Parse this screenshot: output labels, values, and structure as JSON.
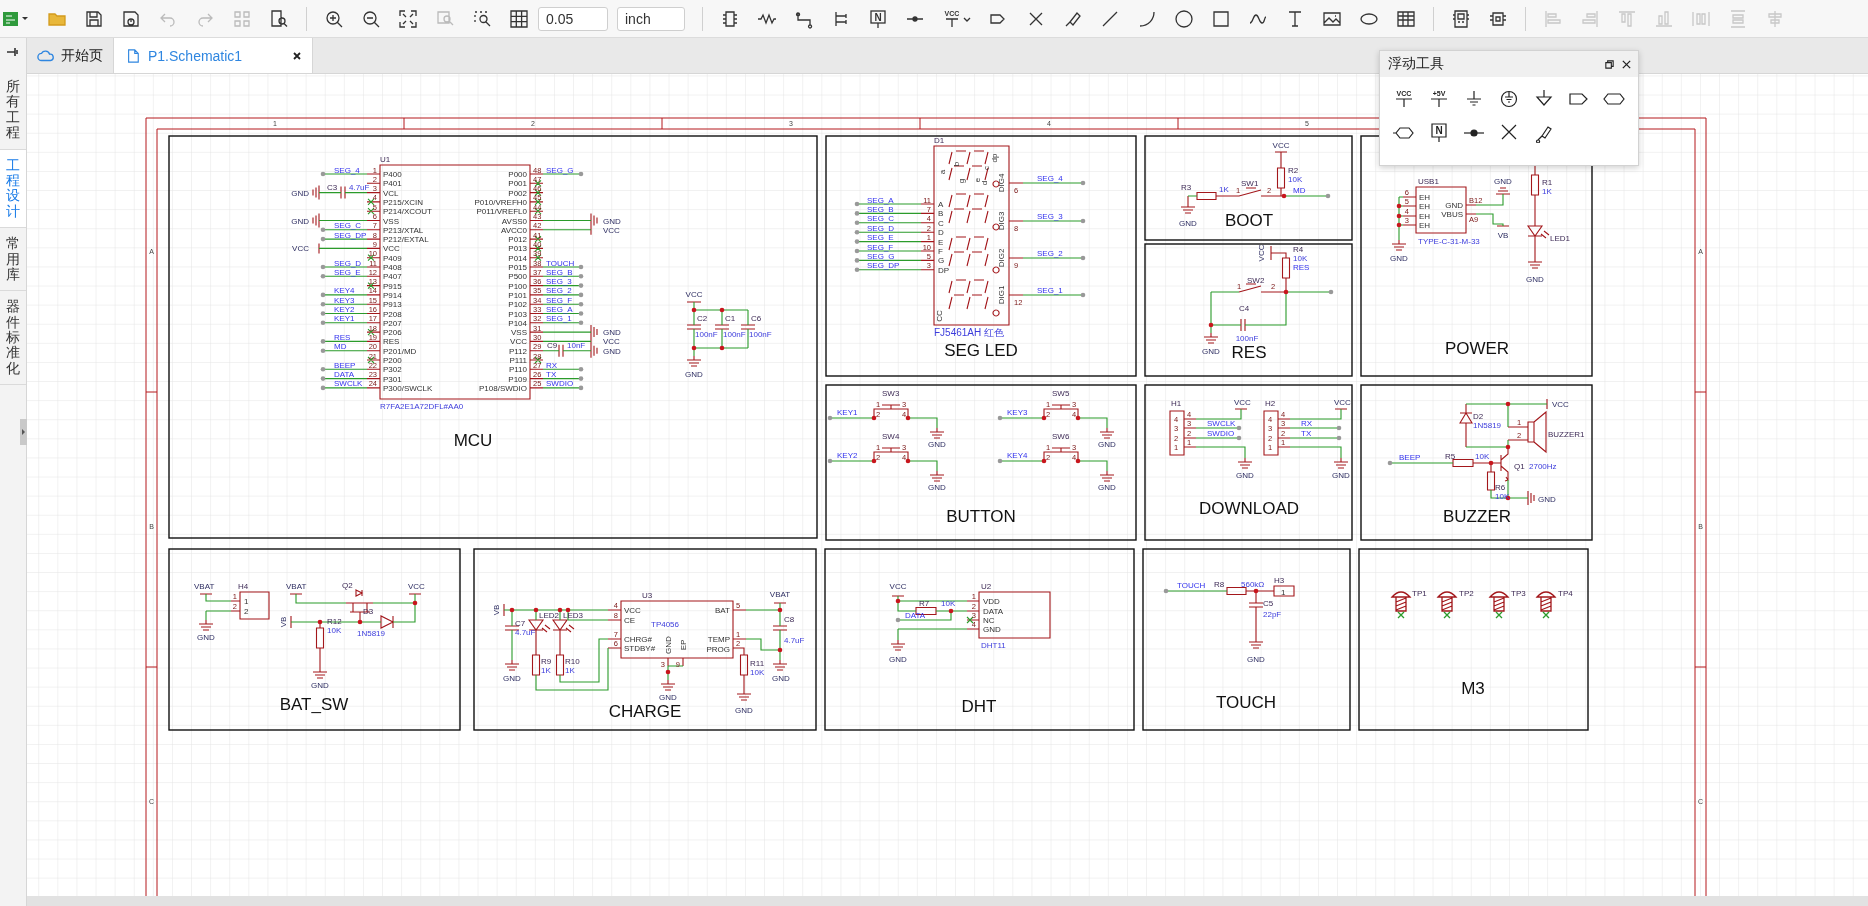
{
  "toolbar": {
    "power_label": "VCC",
    "netlabel_label": "N",
    "grid_size": "0.05",
    "unit": "inch"
  },
  "sidebar": {
    "items": [
      {
        "label": "所有工程",
        "selected": false
      },
      {
        "label": "工程设计",
        "selected": true
      },
      {
        "label": "常用库",
        "selected": false
      },
      {
        "label": "器件标准化",
        "selected": false
      }
    ]
  },
  "tabs": [
    {
      "label": "开始页",
      "kind": "start",
      "selected": false,
      "closable": false
    },
    {
      "label": "P1.Schematic1",
      "kind": "schematic",
      "selected": true,
      "closable": true
    }
  ],
  "floating_tools": {
    "title": "浮动工具",
    "tools": [
      {
        "kind": "power",
        "label": "VCC"
      },
      {
        "kind": "power",
        "label": "+5V"
      },
      {
        "kind": "ground"
      },
      {
        "kind": "earth"
      },
      {
        "kind": "ground_arrow"
      },
      {
        "kind": "port_out"
      },
      {
        "kind": "port_bi"
      },
      {
        "kind": "port_hex"
      },
      {
        "kind": "netlabel",
        "label": "N"
      },
      {
        "kind": "junction"
      },
      {
        "kind": "no_connect"
      },
      {
        "kind": "probe"
      }
    ]
  },
  "sheet": {
    "column_markers": [
      "1",
      "2",
      "3",
      "4",
      "5"
    ],
    "left_row_markers": [
      "A",
      "B",
      "C"
    ],
    "right_row_markers": [
      "A",
      "B",
      "C"
    ],
    "blocks": [
      {
        "kind": "mcu",
        "title": "MCU",
        "chip": {
          "ref": "U1",
          "value": "R7FA2E1A72DFL#AA0",
          "left_pins": [
            {
              "num": "1",
              "name": "P400",
              "kind": "net",
              "net": "SEG_4"
            },
            {
              "num": "2",
              "name": "P401",
              "kind": "none"
            },
            {
              "num": "3",
              "name": "VCL",
              "kind": "cap",
              "ref": "C3",
              "value": "4.7uF",
              "power": "GND"
            },
            {
              "num": "4",
              "name": "P215/XCIN",
              "kind": "nc"
            },
            {
              "num": "5",
              "name": "P214/XCOUT",
              "kind": "nc"
            },
            {
              "num": "6",
              "name": "VSS",
              "kind": "ground",
              "power": "GND"
            },
            {
              "num": "7",
              "name": "P213/XTAL",
              "kind": "net",
              "net": "SEG_C"
            },
            {
              "num": "8",
              "name": "P212/EXTAL",
              "kind": "net",
              "net": "SEG_DP"
            },
            {
              "num": "9",
              "name": "VCC",
              "kind": "supply",
              "power": "VCC"
            },
            {
              "num": "10",
              "name": "P409",
              "kind": "nc"
            },
            {
              "num": "11",
              "name": "P408",
              "kind": "net",
              "net": "SEG_D"
            },
            {
              "num": "12",
              "name": "P407",
              "kind": "net",
              "net": "SEG_E"
            },
            {
              "num": "13",
              "name": "P915",
              "kind": "nc"
            },
            {
              "num": "14",
              "name": "P914",
              "kind": "net",
              "net": "KEY4"
            },
            {
              "num": "15",
              "name": "P913",
              "kind": "net",
              "net": "KEY3"
            },
            {
              "num": "16",
              "name": "P208",
              "kind": "net",
              "net": "KEY2"
            },
            {
              "num": "17",
              "name": "P207",
              "kind": "net",
              "net": "KEY1"
            },
            {
              "num": "18",
              "name": "P206",
              "kind": "nc"
            },
            {
              "num": "19",
              "name": "RES",
              "kind": "net",
              "net": "RES"
            },
            {
              "num": "20",
              "name": "P201/MD",
              "kind": "net",
              "net": "MD"
            },
            {
              "num": "21",
              "name": "P200",
              "kind": "nc"
            },
            {
              "num": "22",
              "name": "P302",
              "kind": "net",
              "net": "BEEP"
            },
            {
              "num": "23",
              "name": "P301",
              "kind": "net",
              "net": "DATA"
            },
            {
              "num": "24",
              "name": "P300/SWCLK",
              "kind": "net",
              "net": "SWCLK"
            }
          ],
          "right_pins": [
            {
              "num": "48",
              "name": "P000",
              "kind": "net",
              "net": "SEG_G"
            },
            {
              "num": "47",
              "name": "P001",
              "kind": "nc"
            },
            {
              "num": "46",
              "name": "P002",
              "kind": "nc"
            },
            {
              "num": "45",
              "name": "P010/VREFH0",
              "kind": "nc"
            },
            {
              "num": "44",
              "name": "P011/VREFL0",
              "kind": "nc"
            },
            {
              "num": "43",
              "name": "AVSS0",
              "kind": "ground",
              "power": "GND"
            },
            {
              "num": "42",
              "name": "AVCC0",
              "kind": "supply",
              "power": "VCC"
            },
            {
              "num": "41",
              "name": "P012",
              "kind": "nc"
            },
            {
              "num": "40",
              "name": "P013",
              "kind": "nc"
            },
            {
              "num": "39",
              "name": "P014",
              "kind": "nc"
            },
            {
              "num": "38",
              "name": "P015",
              "kind": "net",
              "net": "TOUCH"
            },
            {
              "num": "37",
              "name": "P500",
              "kind": "net",
              "net": "SEG_B"
            },
            {
              "num": "36",
              "name": "P100",
              "kind": "net",
              "net": "SEG_3"
            },
            {
              "num": "35",
              "name": "P101",
              "kind": "net",
              "net": "SEG_2"
            },
            {
              "num": "34",
              "name": "P102",
              "kind": "net",
              "net": "SEG_F"
            },
            {
              "num": "33",
              "name": "P103",
              "kind": "net",
              "net": "SEG_A"
            },
            {
              "num": "32",
              "name": "P104",
              "kind": "net",
              "net": "SEG_1"
            },
            {
              "num": "31",
              "name": "VSS",
              "kind": "ground",
              "power": "GND"
            },
            {
              "num": "30",
              "name": "VCC",
              "kind": "supply",
              "power": "VCC"
            },
            {
              "num": "29",
              "name": "P112",
              "kind": "cap",
              "ref": "C9",
              "value": "10nF",
              "power": "GND"
            },
            {
              "num": "28",
              "name": "P111",
              "kind": "nc"
            },
            {
              "num": "27",
              "name": "P110",
              "kind": "net",
              "net": "RX"
            },
            {
              "num": "26",
              "name": "P109",
              "kind": "net",
              "net": "TX"
            },
            {
              "num": "25",
              "name": "P108/SWDIO",
              "kind": "net",
              "net": "SWDIO"
            }
          ]
        },
        "decoupling": {
          "supply": "VCC",
          "ground": "GND",
          "caps": [
            {
              "ref": "C2",
              "value": "100nF"
            },
            {
              "ref": "C1",
              "value": "100nF"
            },
            {
              "ref": "C6",
              "value": "100nF"
            }
          ]
        }
      },
      {
        "kind": "seg_led",
        "title": "SEG LED",
        "chip": {
          "ref": "D1",
          "value": "FJ5461AH 红色",
          "common": "CC",
          "segment_letters": [
            "a",
            "b",
            "g",
            "e",
            "d",
            "c",
            "dp"
          ],
          "left_pins": [
            {
              "net": "SEG_A",
              "num": "11",
              "name": "A"
            },
            {
              "net": "SEG_B",
              "num": "7",
              "name": "B"
            },
            {
              "net": "SEG_C",
              "num": "4",
              "name": "C"
            },
            {
              "net": "SEG_D",
              "num": "2",
              "name": "D"
            },
            {
              "net": "SEG_E",
              "num": "1",
              "name": "E"
            },
            {
              "net": "SEG_F",
              "num": "10",
              "name": "F"
            },
            {
              "net": "SEG_G",
              "num": "5",
              "name": "G"
            },
            {
              "net": "SEG_DP",
              "num": "3",
              "name": "DP"
            }
          ],
          "right_pins": [
            {
              "name": "DIG4",
              "num": "6",
              "net": "SEG_4"
            },
            {
              "name": "DIG3",
              "num": "8",
              "net": "SEG_3"
            },
            {
              "name": "DIG2",
              "num": "9",
              "net": "SEG_2"
            },
            {
              "name": "DIG1",
              "num": "12",
              "net": "SEG_1"
            }
          ]
        }
      },
      {
        "kind": "boot",
        "title": "BOOT",
        "labels": [
          {
            "text": "R3",
            "kind": "ref"
          },
          {
            "text": "1K",
            "kind": "value"
          },
          {
            "text": "1",
            "kind": "pin"
          },
          {
            "text": "SW1",
            "kind": "ref"
          },
          {
            "text": "2",
            "kind": "pin"
          },
          {
            "text": "VCC",
            "kind": "power"
          },
          {
            "text": "R2",
            "kind": "ref"
          },
          {
            "text": "10K",
            "kind": "value"
          },
          {
            "text": "MD",
            "kind": "net"
          },
          {
            "text": "GND",
            "kind": "power"
          }
        ]
      },
      {
        "kind": "res",
        "title": "RES",
        "labels": [
          {
            "text": "VCC",
            "kind": "power"
          },
          {
            "text": "R4",
            "kind": "ref"
          },
          {
            "text": "10K",
            "kind": "value"
          },
          {
            "text": "RES",
            "kind": "net"
          },
          {
            "text": "1",
            "kind": "pin"
          },
          {
            "text": "SW2",
            "kind": "ref"
          },
          {
            "text": "2",
            "kind": "pin"
          },
          {
            "text": "C4",
            "kind": "ref"
          },
          {
            "text": "100nF",
            "kind": "value"
          },
          {
            "text": "GND",
            "kind": "power"
          }
        ]
      },
      {
        "kind": "power",
        "title": "POWER",
        "labels": [
          {
            "text": "USB1",
            "kind": "ref"
          },
          {
            "text": "6",
            "kind": "pin"
          },
          {
            "text": "5",
            "kind": "pin"
          },
          {
            "text": "4",
            "kind": "pin"
          },
          {
            "text": "3",
            "kind": "pin"
          },
          {
            "text": "EH",
            "kind": "pinname"
          },
          {
            "text": "EH",
            "kind": "pinname"
          },
          {
            "text": "EH",
            "kind": "pinname"
          },
          {
            "text": "EH",
            "kind": "pinname"
          },
          {
            "text": "GND",
            "kind": "pinname"
          },
          {
            "text": "VBUS",
            "kind": "pinname"
          },
          {
            "text": "B12",
            "kind": "pin"
          },
          {
            "text": "A9",
            "kind": "pin"
          },
          {
            "text": "GND",
            "kind": "power"
          },
          {
            "text": "VB",
            "kind": "power"
          },
          {
            "text": "TYPE-C-31-M-33",
            "kind": "value"
          },
          {
            "text": "R1",
            "kind": "ref"
          },
          {
            "text": "1K",
            "kind": "value"
          },
          {
            "text": "LED1",
            "kind": "ref"
          },
          {
            "text": "GND",
            "kind": "power"
          },
          {
            "text": "GND",
            "kind": "power"
          }
        ]
      },
      {
        "kind": "button",
        "title": "BUTTON",
        "labels": [
          {
            "text": "SW3",
            "kind": "ref"
          },
          {
            "text": "KEY1",
            "kind": "net"
          },
          {
            "text": "1",
            "kind": "pin"
          },
          {
            "text": "2",
            "kind": "pin"
          },
          {
            "text": "3",
            "kind": "pin"
          },
          {
            "text": "4",
            "kind": "pin"
          },
          {
            "text": "GND",
            "kind": "power"
          },
          {
            "text": "SW4",
            "kind": "ref"
          },
          {
            "text": "KEY2",
            "kind": "net"
          },
          {
            "text": "1",
            "kind": "pin"
          },
          {
            "text": "2",
            "kind": "pin"
          },
          {
            "text": "3",
            "kind": "pin"
          },
          {
            "text": "4",
            "kind": "pin"
          },
          {
            "text": "GND",
            "kind": "power"
          },
          {
            "text": "SW5",
            "kind": "ref"
          },
          {
            "text": "KEY3",
            "kind": "net"
          },
          {
            "text": "1",
            "kind": "pin"
          },
          {
            "text": "2",
            "kind": "pin"
          },
          {
            "text": "3",
            "kind": "pin"
          },
          {
            "text": "4",
            "kind": "pin"
          },
          {
            "text": "GND",
            "kind": "power"
          },
          {
            "text": "SW6",
            "kind": "ref"
          },
          {
            "text": "KEY4",
            "kind": "net"
          },
          {
            "text": "1",
            "kind": "pin"
          },
          {
            "text": "2",
            "kind": "pin"
          },
          {
            "text": "3",
            "kind": "pin"
          },
          {
            "text": "4",
            "kind": "pin"
          },
          {
            "text": "GND",
            "kind": "power"
          }
        ]
      },
      {
        "kind": "download",
        "title": "DOWNLOAD",
        "labels": [
          {
            "text": "H1",
            "kind": "ref"
          },
          {
            "text": "4",
            "kind": "pin"
          },
          {
            "text": "3",
            "kind": "pin"
          },
          {
            "text": "2",
            "kind": "pin"
          },
          {
            "text": "1",
            "kind": "pin"
          },
          {
            "text": "4",
            "kind": "pin"
          },
          {
            "text": "3",
            "kind": "pin"
          },
          {
            "text": "2",
            "kind": "pin"
          },
          {
            "text": "1",
            "kind": "pin"
          },
          {
            "text": "VCC",
            "kind": "power"
          },
          {
            "text": "SWCLK",
            "kind": "net"
          },
          {
            "text": "SWDIO",
            "kind": "net"
          },
          {
            "text": "GND",
            "kind": "power"
          },
          {
            "text": "H2",
            "kind": "ref"
          },
          {
            "text": "4",
            "kind": "pin"
          },
          {
            "text": "3",
            "kind": "pin"
          },
          {
            "text": "2",
            "kind": "pin"
          },
          {
            "text": "1",
            "kind": "pin"
          },
          {
            "text": "4",
            "kind": "pin"
          },
          {
            "text": "3",
            "kind": "pin"
          },
          {
            "text": "2",
            "kind": "pin"
          },
          {
            "text": "1",
            "kind": "pin"
          },
          {
            "text": "VCC",
            "kind": "power"
          },
          {
            "text": "RX",
            "kind": "net"
          },
          {
            "text": "TX",
            "kind": "net"
          },
          {
            "text": "GND",
            "kind": "power"
          }
        ]
      },
      {
        "kind": "buzzer",
        "title": "BUZZER",
        "labels": [
          {
            "text": "VCC",
            "kind": "power"
          },
          {
            "text": "D2",
            "kind": "ref"
          },
          {
            "text": "1N5819",
            "kind": "value"
          },
          {
            "text": "1",
            "kind": "pin"
          },
          {
            "text": "2",
            "kind": "pin"
          },
          {
            "text": "BUZZER1",
            "kind": "ref"
          },
          {
            "text": "BEEP",
            "kind": "net"
          },
          {
            "text": "R5",
            "kind": "ref"
          },
          {
            "text": "10K",
            "kind": "value"
          },
          {
            "text": "Q1",
            "kind": "ref"
          },
          {
            "text": "2700Hz",
            "kind": "value"
          },
          {
            "text": "R6",
            "kind": "ref"
          },
          {
            "text": "10K",
            "kind": "value"
          },
          {
            "text": "GND",
            "kind": "power"
          }
        ]
      },
      {
        "kind": "bat_sw",
        "title": "BAT_SW",
        "labels": [
          {
            "text": "VBAT",
            "kind": "power"
          },
          {
            "text": "H4",
            "kind": "ref"
          },
          {
            "text": "1",
            "kind": "pin"
          },
          {
            "text": "2",
            "kind": "pin"
          },
          {
            "text": "1",
            "kind": "pinname"
          },
          {
            "text": "2",
            "kind": "pinname"
          },
          {
            "text": "GND",
            "kind": "power"
          },
          {
            "text": "VBAT",
            "kind": "power"
          },
          {
            "text": "Q2",
            "kind": "ref"
          },
          {
            "text": "VCC",
            "kind": "power"
          },
          {
            "text": "D3",
            "kind": "ref"
          },
          {
            "text": "1N5819",
            "kind": "value"
          },
          {
            "text": "VB",
            "kind": "power"
          },
          {
            "text": "R12",
            "kind": "ref"
          },
          {
            "text": "10K",
            "kind": "value"
          },
          {
            "text": "GND",
            "kind": "power"
          }
        ]
      },
      {
        "kind": "charge",
        "title": "CHARGE",
        "labels": [
          {
            "text": "VB",
            "kind": "power"
          },
          {
            "text": "C7",
            "kind": "ref"
          },
          {
            "text": "4.7uF",
            "kind": "value"
          },
          {
            "text": "LED2",
            "kind": "ref"
          },
          {
            "text": "LED3",
            "kind": "ref"
          },
          {
            "text": "R9",
            "kind": "ref"
          },
          {
            "text": "1K",
            "kind": "value"
          },
          {
            "text": "R10",
            "kind": "ref"
          },
          {
            "text": "1K",
            "kind": "value"
          },
          {
            "text": "GND",
            "kind": "power"
          },
          {
            "text": "U3",
            "kind": "ref"
          },
          {
            "text": "VCC",
            "kind": "pinname"
          },
          {
            "text": "CE",
            "kind": "pinname"
          },
          {
            "text": "CHRG#",
            "kind": "pinname"
          },
          {
            "text": "STDBY#",
            "kind": "pinname"
          },
          {
            "text": "4",
            "kind": "pin"
          },
          {
            "text": "8",
            "kind": "pin"
          },
          {
            "text": "7",
            "kind": "pin"
          },
          {
            "text": "6",
            "kind": "pin"
          },
          {
            "text": "TP4056",
            "kind": "value"
          },
          {
            "text": "BAT",
            "kind": "pinname"
          },
          {
            "text": "TEMP",
            "kind": "pinname"
          },
          {
            "text": "PROG",
            "kind": "pinname"
          },
          {
            "text": "5",
            "kind": "pin"
          },
          {
            "text": "1",
            "kind": "pin"
          },
          {
            "text": "2",
            "kind": "pin"
          },
          {
            "text": "GND",
            "kind": "pinname"
          },
          {
            "text": "EP",
            "kind": "pinname"
          },
          {
            "text": "3",
            "kind": "pin"
          },
          {
            "text": "9",
            "kind": "pin"
          },
          {
            "text": "GND",
            "kind": "power"
          },
          {
            "text": "VBAT",
            "kind": "power"
          },
          {
            "text": "C8",
            "kind": "ref"
          },
          {
            "text": "4.7uF",
            "kind": "value"
          },
          {
            "text": "GND",
            "kind": "power"
          },
          {
            "text": "R11",
            "kind": "ref"
          },
          {
            "text": "10K",
            "kind": "value"
          },
          {
            "text": "GND",
            "kind": "power"
          }
        ]
      },
      {
        "kind": "dht",
        "title": "DHT",
        "labels": [
          {
            "text": "VCC",
            "kind": "power"
          },
          {
            "text": "R7",
            "kind": "ref"
          },
          {
            "text": "10K",
            "kind": "value"
          },
          {
            "text": "DATA",
            "kind": "net"
          },
          {
            "text": "GND",
            "kind": "power"
          },
          {
            "text": "U2",
            "kind": "ref"
          },
          {
            "text": "1",
            "kind": "pin"
          },
          {
            "text": "2",
            "kind": "pin"
          },
          {
            "text": "3",
            "kind": "pin"
          },
          {
            "text": "4",
            "kind": "pin"
          },
          {
            "text": "VDD",
            "kind": "pinname"
          },
          {
            "text": "DATA",
            "kind": "pinname"
          },
          {
            "text": "NC",
            "kind": "pinname"
          },
          {
            "text": "GND",
            "kind": "pinname"
          },
          {
            "text": "DHT11",
            "kind": "value"
          }
        ]
      },
      {
        "kind": "touch",
        "title": "TOUCH",
        "labels": [
          {
            "text": "TOUCH",
            "kind": "net"
          },
          {
            "text": "R8",
            "kind": "ref"
          },
          {
            "text": "560kΩ",
            "kind": "value"
          },
          {
            "text": "H3",
            "kind": "ref"
          },
          {
            "text": "1",
            "kind": "pinname"
          },
          {
            "text": "C5",
            "kind": "ref"
          },
          {
            "text": "22pF",
            "kind": "value"
          },
          {
            "text": "GND",
            "kind": "power"
          }
        ]
      },
      {
        "kind": "m3",
        "title": "M3",
        "labels": [
          {
            "text": "TP1",
            "kind": "ref"
          },
          {
            "text": "TP2",
            "kind": "ref"
          },
          {
            "text": "TP3",
            "kind": "ref"
          },
          {
            "text": "TP4",
            "kind": "ref"
          }
        ]
      }
    ]
  }
}
